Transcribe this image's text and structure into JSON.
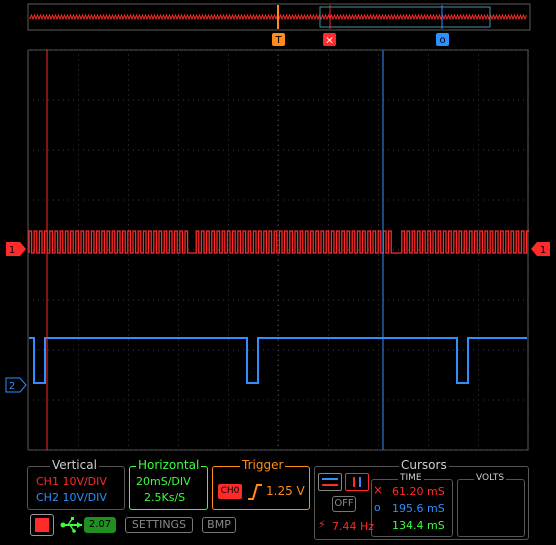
{
  "colors": {
    "ch1": "#ff2a2a",
    "ch2": "#2f8fff",
    "trigger": "#ff8c1a",
    "grid": "#3b3b3b",
    "frame": "#5a5a5a",
    "green": "#3cff3c"
  },
  "markers": {
    "trigger_top": "T",
    "cursor_x": "×",
    "cursor_o": "o",
    "ch2_left": "2",
    "ch1_right": "1",
    "ch1_left": "1"
  },
  "vertical": {
    "title": "Vertical",
    "ch1": "CH1 10V/DIV",
    "ch2": "CH2 10V/DIV"
  },
  "horizontal": {
    "title": "Horizontal",
    "timebase": "20mS/DIV",
    "rate": "2.5Ks/S"
  },
  "trigger": {
    "title": "Trigger",
    "source": "CH0",
    "level": "1.25 V"
  },
  "cursors": {
    "title": "Cursors",
    "time_title": "TIME",
    "volts_title": "VOLTS",
    "off_label": "OFF",
    "x_time": "61.20 mS",
    "o_time": "195.6 mS",
    "delta_time": "134.4 mS",
    "frequency": "7.44 Hz"
  },
  "bottom": {
    "version": "2.07",
    "settings": "SETTINGS",
    "bmp": "BMP"
  },
  "icons": {
    "run_stop": "stop-square-icon",
    "usb": "usb-icon",
    "edge": "rising-edge-icon"
  }
}
